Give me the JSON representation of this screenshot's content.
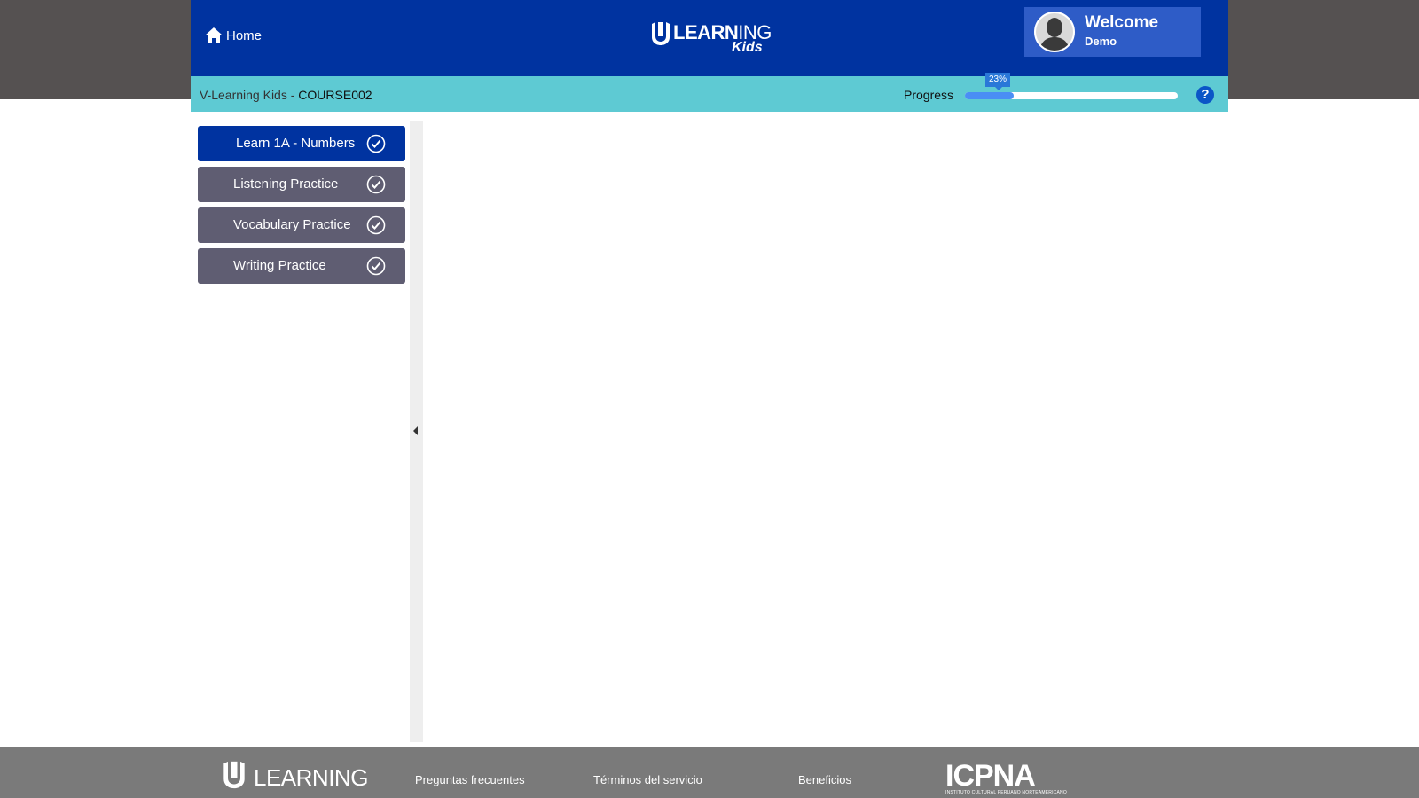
{
  "header": {
    "home_label": "Home",
    "logo_word_bold": "LEARN",
    "logo_word_light": "ING",
    "logo_sub": "Kids",
    "welcome": "Welcome",
    "username": "Demo"
  },
  "subbar": {
    "course_prefix": "V-Learning Kids - ",
    "course_code": "COURSE002",
    "progress_label": "Progress",
    "progress_percent": 23,
    "progress_text": "23%",
    "help_label": "?"
  },
  "sidebar": {
    "items": [
      {
        "label": "Learn 1A - Numbers",
        "active": true
      },
      {
        "label": "Listening Practice",
        "active": false
      },
      {
        "label": "Vocabulary Practice",
        "active": false
      },
      {
        "label": "Writing Practice",
        "active": false
      }
    ]
  },
  "footer": {
    "logo_word": "LEARNING",
    "links": [
      "Preguntas frecuentes",
      "Términos del servicio",
      "Beneficios"
    ],
    "partner_logo": "ICPNA",
    "partner_tagline": "INSTITUTO CULTURAL PERUANO NORTEAMERICANO"
  },
  "colors": {
    "header_bg": "#0033a0",
    "subbar_bg": "#5ecad3",
    "lesson_bg": "#5f5d72",
    "progress_fill": "#4a8ef5"
  }
}
